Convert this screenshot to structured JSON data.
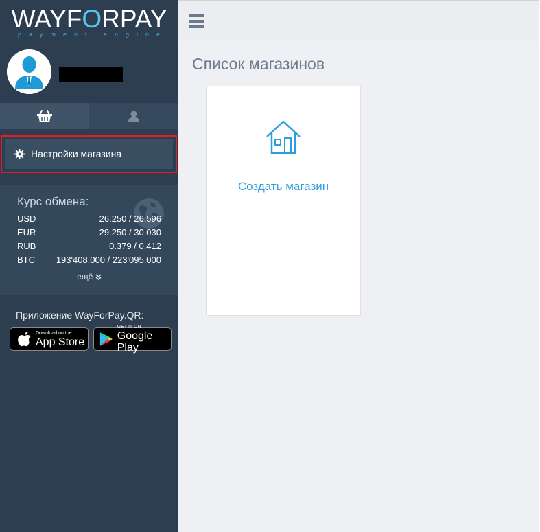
{
  "logo": {
    "part1": "WAYF",
    "accent": "O",
    "part2": "RPAY",
    "subtitle": "payment engine"
  },
  "profile": {
    "username": ""
  },
  "tabs": [
    {
      "name": "shops",
      "icon": "basket-icon",
      "active": true
    },
    {
      "name": "profile",
      "icon": "user-icon",
      "active": false
    }
  ],
  "menu": {
    "shop_settings_label": "Настройки магазина"
  },
  "exchange_rates": {
    "title": "Курс обмена:",
    "rows": [
      {
        "currency": "USD",
        "value": "26.250 / 26.596"
      },
      {
        "currency": "EUR",
        "value": "29.250 / 30.030"
      },
      {
        "currency": "RUB",
        "value": "0.379 / 0.412"
      },
      {
        "currency": "BTC",
        "value": "193'408.000 / 223'095.000"
      }
    ],
    "more_label": "ещё"
  },
  "apps": {
    "title": "Приложение WayForPay.QR:",
    "appstore_small": "Download on the",
    "appstore_big": "App Store",
    "google_small": "GET IT ON",
    "google_big": "Google Play"
  },
  "main": {
    "title": "Список магазинов",
    "create_shop_label": "Создать магазин"
  },
  "colors": {
    "sidebar": "#2c3e50",
    "accent": "#2e9fdc",
    "highlight_border": "#e21d23"
  }
}
